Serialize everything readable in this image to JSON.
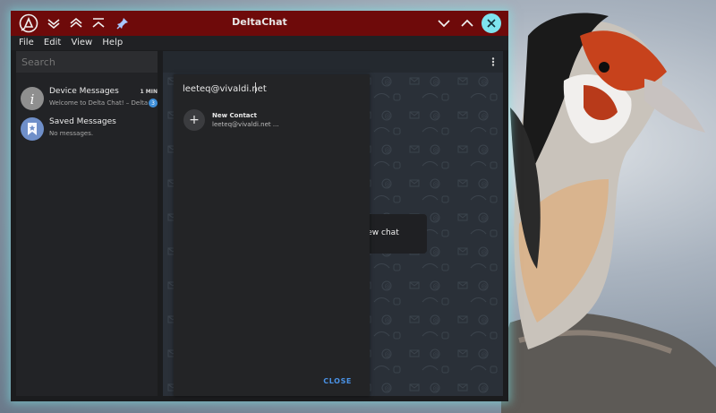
{
  "app": {
    "title": "DeltaChat"
  },
  "menu": {
    "items": [
      "File",
      "Edit",
      "View",
      "Help"
    ]
  },
  "search": {
    "placeholder": "Search"
  },
  "chats": [
    {
      "title": "Device Messages",
      "subtitle": "Welcome to Delta Chat! – Delta ...",
      "time": "1 MIN",
      "badge": "3"
    },
    {
      "title": "Saved Messages",
      "subtitle": "No messages."
    }
  ],
  "main": {
    "toast_text": "n new chat"
  },
  "dialog": {
    "input_value": "leeteq@vivaldi.net",
    "new_contact_label": "New Contact",
    "new_contact_value": "leeteq@vivaldi.net ...",
    "close_label": "CLOSE"
  },
  "icons": {
    "app_logo": "delta-logo-icon",
    "down_chevrons": "double-chevron-down-icon",
    "up_chevrons": "double-chevron-up-icon",
    "up_to_top": "chevron-up-to-top-icon",
    "pin": "pin-icon",
    "kebab": "more-vertical-icon",
    "plus": "plus-icon"
  },
  "colors": {
    "titlebar": "#6e0a0a",
    "accent": "#4a92e6",
    "close_circle": "#7ee3ee",
    "badge": "#3e8ed8"
  }
}
